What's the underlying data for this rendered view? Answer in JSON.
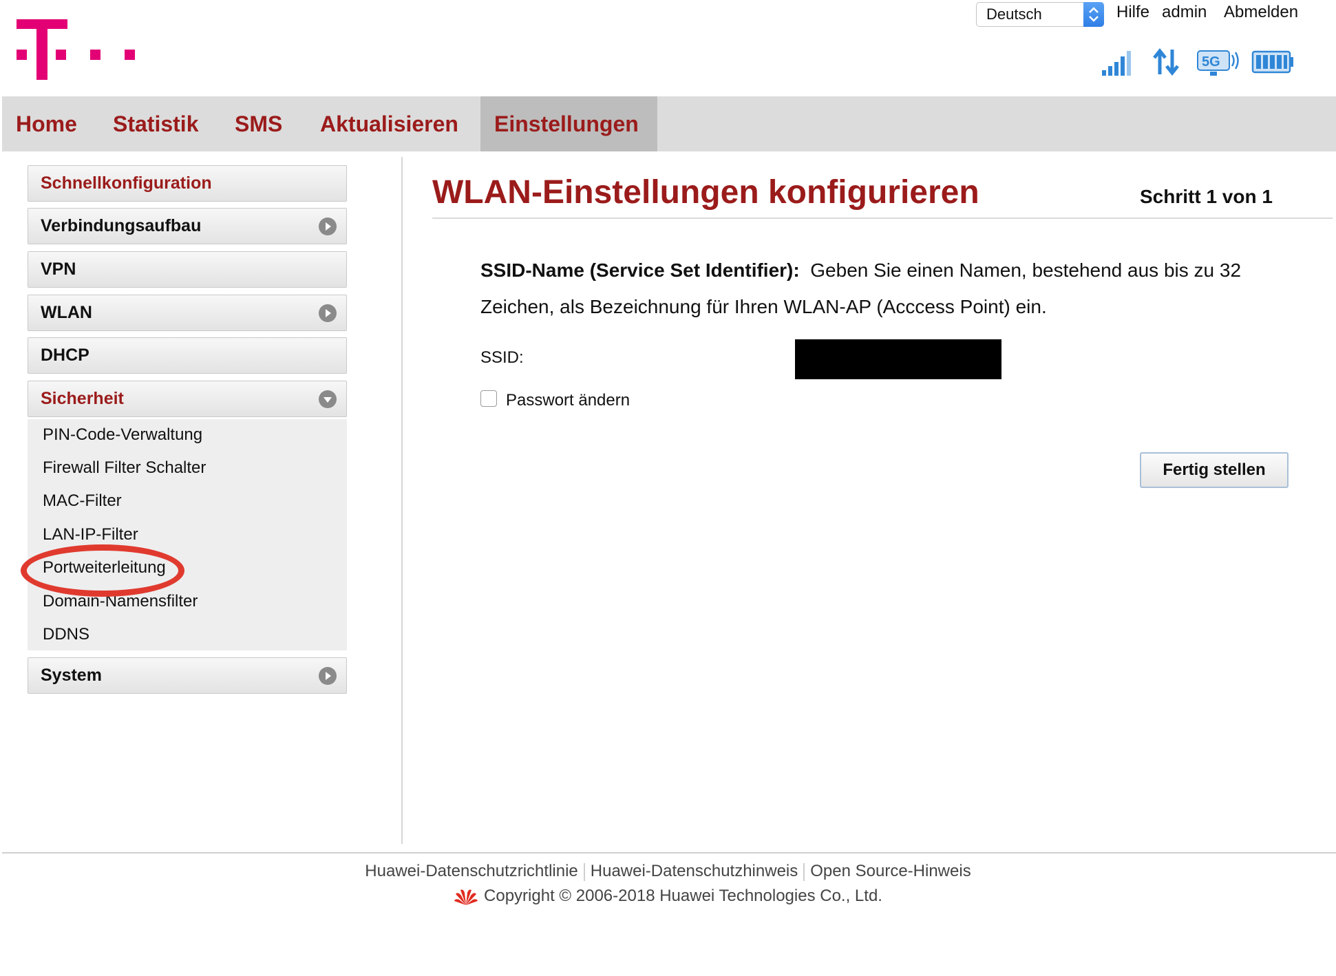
{
  "header": {
    "language_selected": "Deutsch",
    "links": {
      "help": "Hilfe",
      "user": "admin",
      "logout": "Abmelden"
    },
    "brand_color": "#e20074",
    "status_icons": [
      "signal-strength-icon",
      "data-transfer-icon",
      "5g-wifi-icon",
      "battery-icon"
    ]
  },
  "nav": {
    "items": [
      "Home",
      "Statistik",
      "SMS",
      "Aktualisieren",
      "Einstellungen"
    ],
    "active": "Einstellungen",
    "accent_color": "#9b1b1b"
  },
  "sidebar": {
    "items": [
      {
        "label": "Schnellkonfiguration"
      },
      {
        "label": "Verbindungsaufbau"
      },
      {
        "label": "VPN"
      },
      {
        "label": "WLAN"
      },
      {
        "label": "DHCP"
      },
      {
        "label": "Sicherheit"
      },
      {
        "label": "System"
      }
    ],
    "submenu": [
      "PIN-Code-Verwaltung",
      "Firewall Filter Schalter",
      "MAC-Filter",
      "LAN-IP-Filter",
      "Portweiterleitung",
      "Domain-Namensfilter",
      "DDNS"
    ],
    "highlight_color": "#e03a2f"
  },
  "content": {
    "title": "WLAN-Einstellungen konfigurieren",
    "step": "Schritt 1 von 1",
    "desc_label": "SSID-Name (Service Set Identifier):",
    "desc_text": "Geben Sie einen Namen, bestehend aus bis zu 32 Zeichen, als Bezeichnung für Ihren WLAN-AP (Acccess Point) ein.",
    "ssid_label": "SSID:",
    "ssid_value": "",
    "password_change_label": "Passwort ändern",
    "password_change_checked": false,
    "finish_button": "Fertig stellen"
  },
  "footer": {
    "links": [
      "Huawei-Datenschutzrichtlinie",
      "Huawei-Datenschutzhinweis",
      "Open Source-Hinweis"
    ],
    "copyright": "Copyright © 2006-2018 Huawei Technologies Co., Ltd."
  }
}
